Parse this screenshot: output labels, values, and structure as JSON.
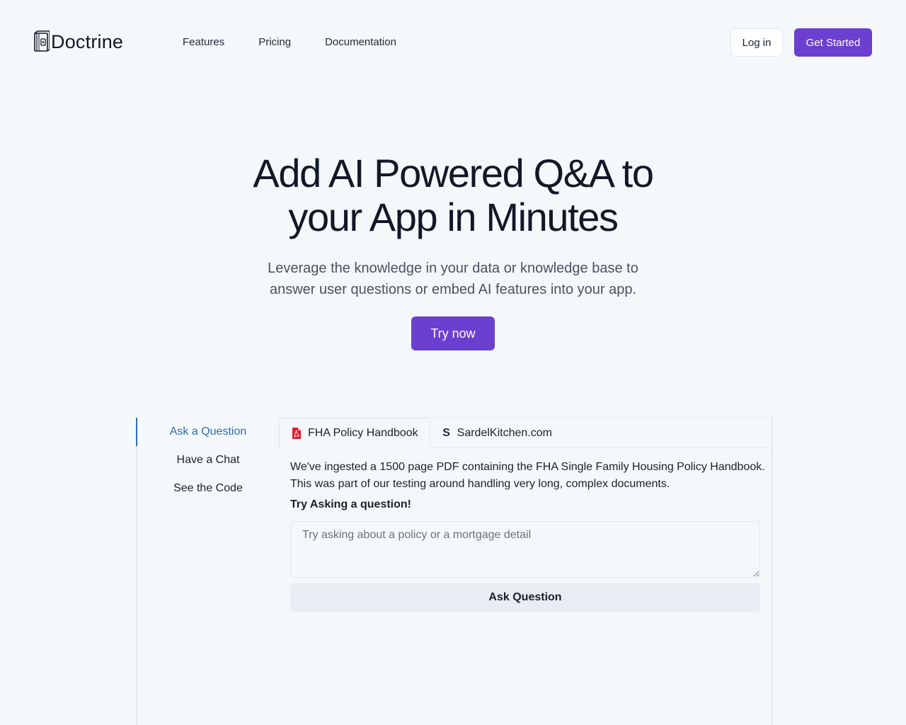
{
  "brand": {
    "name": "Doctrine",
    "logo_icon": "book-safe-icon",
    "accent_color": "#6b3fd0"
  },
  "nav": {
    "items": [
      "Features",
      "Pricing",
      "Documentation"
    ]
  },
  "header_actions": {
    "login_label": "Log in",
    "get_started_label": "Get Started"
  },
  "hero": {
    "title_line1": "Add AI Powered Q&A to",
    "title_line2": "your App in Minutes",
    "subtitle_line1": "Leverage the knowledge in your data or knowledge base to",
    "subtitle_line2": "answer user questions or embed AI features into your app.",
    "cta_label": "Try now"
  },
  "demo": {
    "side_tabs": [
      {
        "label": "Ask a Question",
        "active": true
      },
      {
        "label": "Have a Chat",
        "active": false
      },
      {
        "label": "See the Code",
        "active": false
      }
    ],
    "source_tabs": [
      {
        "label": "FHA Policy Handbook",
        "icon": "pdf-file-icon",
        "active": true
      },
      {
        "label": "SardelKitchen.com",
        "icon": "s-logo-icon",
        "active": false
      }
    ],
    "description": "We've ingested a 1500 page PDF containing the FHA Single Family Housing Policy Handbook. This was part of our testing around handling very long, complex documents.",
    "prompt_label": "Try Asking a question!",
    "input_placeholder": "Try asking about a policy or a mortgage detail",
    "input_value": "",
    "ask_button_label": "Ask Question"
  }
}
